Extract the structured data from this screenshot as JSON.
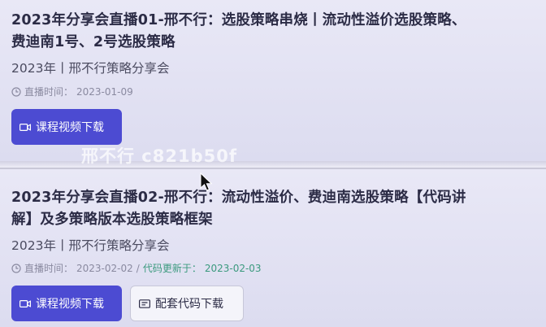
{
  "colors": {
    "primary_button": "#4c4bd2",
    "title_text": "#2c2c46",
    "meta_text": "#8a8aa0",
    "updated_text": "#3b9a7e",
    "watermark": "rgba(255,255,255,0.72)"
  },
  "icons": {
    "clock": "clock-icon",
    "video": "video-icon",
    "code": "code-icon",
    "cursor": "mouse-cursor"
  },
  "courses": [
    {
      "title_line1": "2023年分享会直播01-邢不行：选股策略串烧丨流动性溢价选股策略、",
      "title_line2": "费迪南1号、2号选股策略",
      "subtitle": "2023年丨邢不行策略分享会",
      "live_time_label": "直播时间：",
      "live_time": "2023-01-09",
      "video_button": "课程视频下载"
    },
    {
      "title_line1": "2023年分享会直播02-邢不行：流动性溢价、费迪南选股策略【代码讲",
      "title_line2": "解】及多策略版本选股策略框架",
      "subtitle": "2023年丨邢不行策略分享会",
      "live_time_label": "直播时间：",
      "live_time": "2023-02-02",
      "separator": "/",
      "updated_label": "代码更新于：",
      "updated_time": "2023-02-03",
      "video_button": "课程视频下载",
      "code_button": "配套代码下载"
    }
  ],
  "watermark": "邢不行 c821b50f"
}
